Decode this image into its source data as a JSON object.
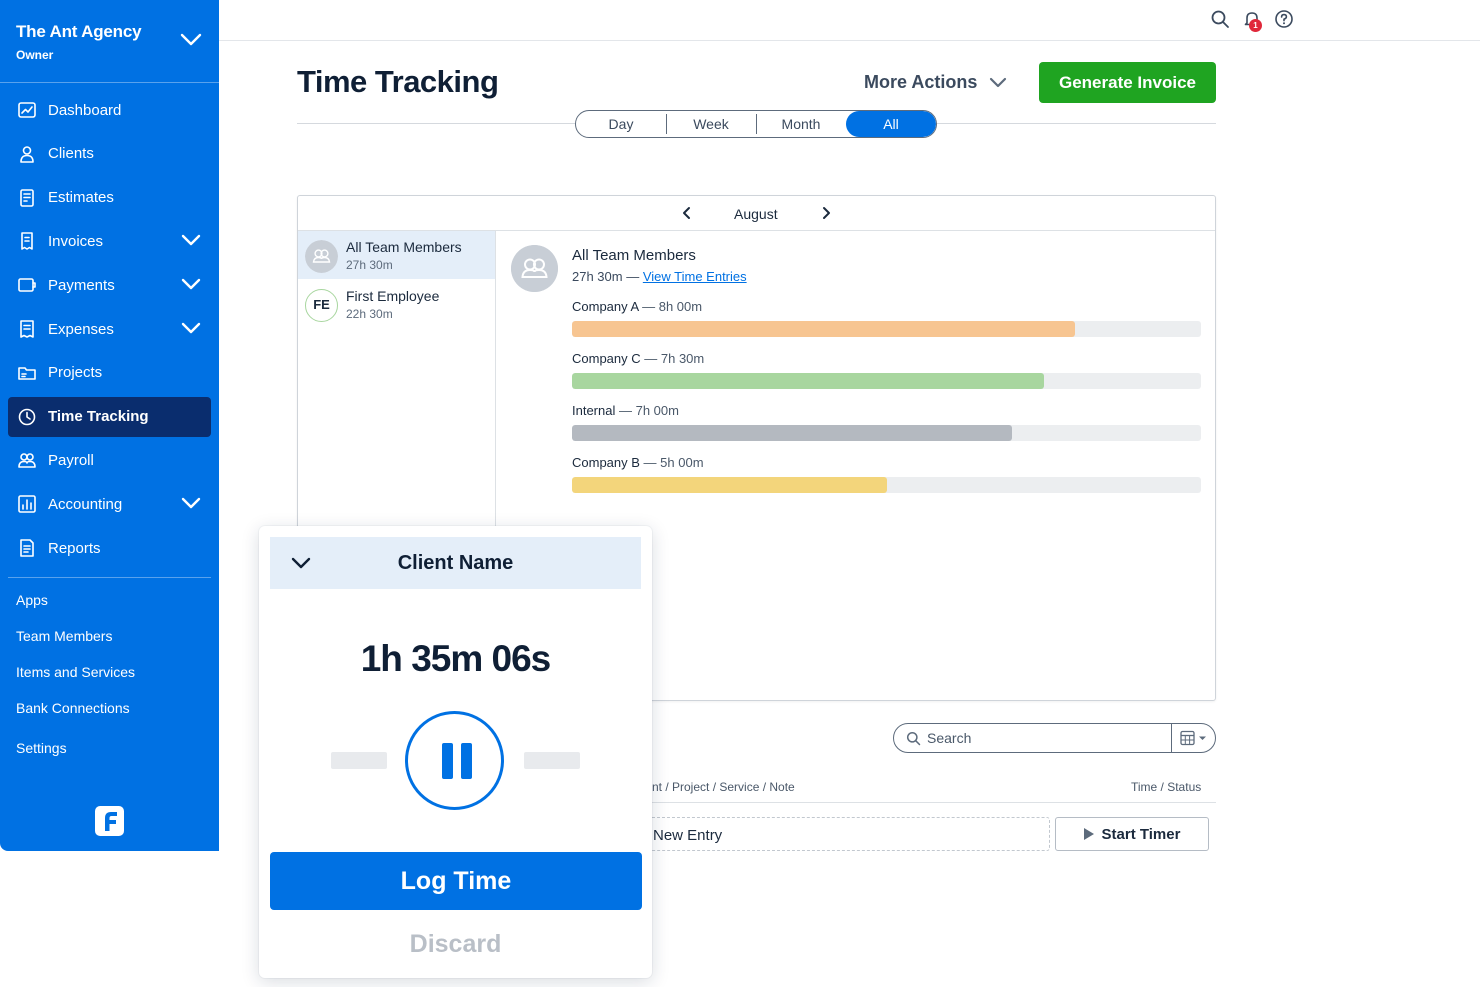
{
  "org": {
    "name": "The Ant Agency",
    "role": "Owner"
  },
  "sidebar": {
    "items": [
      {
        "label": "Dashboard",
        "icon": "dashboard-icon"
      },
      {
        "label": "Clients",
        "icon": "clients-icon"
      },
      {
        "label": "Estimates",
        "icon": "estimates-icon"
      },
      {
        "label": "Invoices",
        "icon": "invoices-icon",
        "expandable": true
      },
      {
        "label": "Payments",
        "icon": "payments-icon",
        "expandable": true
      },
      {
        "label": "Expenses",
        "icon": "expenses-icon",
        "expandable": true
      },
      {
        "label": "Projects",
        "icon": "projects-icon"
      },
      {
        "label": "Time Tracking",
        "icon": "clock-icon",
        "active": true
      },
      {
        "label": "Payroll",
        "icon": "payroll-icon"
      },
      {
        "label": "Accounting",
        "icon": "accounting-icon",
        "expandable": true
      },
      {
        "label": "Reports",
        "icon": "reports-icon"
      }
    ],
    "links": [
      "Apps",
      "Team Members",
      "Items and Services",
      "Bank Connections",
      "Settings"
    ]
  },
  "topbar": {
    "notification_count": "1"
  },
  "header": {
    "title": "Time Tracking",
    "more_actions": "More Actions",
    "generate_invoice": "Generate Invoice"
  },
  "range_tabs": [
    "Day",
    "Week",
    "Month",
    "All"
  ],
  "range_active": "All",
  "calendar": {
    "month": "August"
  },
  "members": [
    {
      "name": "All Team Members",
      "time": "27h 30m",
      "selected": true
    },
    {
      "name": "First Employee",
      "initials": "FE",
      "time": "22h 30m"
    }
  ],
  "detail": {
    "name": "All Team Members",
    "total": "27h 30m",
    "separator": " — ",
    "view_link": "View Time Entries",
    "breakdown": [
      {
        "label": "Company A",
        "hours": "8h 00m",
        "fraction": 0.8,
        "color": "#f7c591"
      },
      {
        "label": "Company C",
        "hours": "7h 30m",
        "fraction": 0.75,
        "color": "#a8d69f"
      },
      {
        "label": "Internal",
        "hours": "7h 00m",
        "fraction": 0.7,
        "color": "#b4b9c0"
      },
      {
        "label": "Company B",
        "hours": "5h 00m",
        "fraction": 0.5,
        "color": "#f3d57b"
      }
    ]
  },
  "search": {
    "placeholder": "Search"
  },
  "table": {
    "col_left": "nt / Project / Service / Note",
    "col_right": "Time / Status",
    "new_entry": "New Entry",
    "start_timer": "Start Timer"
  },
  "timer": {
    "client": "Client Name",
    "elapsed": "1h 35m 06s",
    "log_time": "Log Time",
    "discard": "Discard"
  },
  "colors": {
    "brand": "#0071e3",
    "sidebar_active": "#0a2d6e",
    "cta_green": "#1fa421"
  }
}
